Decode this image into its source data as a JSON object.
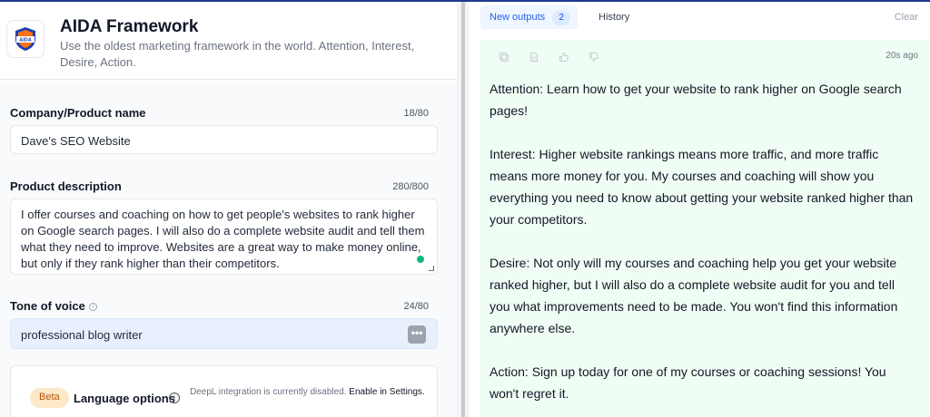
{
  "app": {
    "title": "AIDA Framework",
    "subtitle": "Use the oldest marketing framework in the world. Attention, Interest, Desire, Action.",
    "logo_text": "AIDA"
  },
  "form": {
    "company": {
      "label": "Company/Product name",
      "counter": "18/80",
      "value": "Dave's SEO Website"
    },
    "description": {
      "label": "Product description",
      "counter": "280/800",
      "value": "I offer courses and coaching on how to get people's websites to rank higher on Google search pages. I will also do a complete website audit and tell them what they need to improve. Websites are a great way to make money online, but only if they rank higher than their competitors."
    },
    "tone": {
      "label": "Tone of voice",
      "counter": "24/80",
      "value": "professional blog writer",
      "more_label": "•••"
    },
    "language": {
      "badge": "Beta",
      "label": "Language options",
      "note": "DeepL integration is currently disabled.",
      "link": "Enable in Settings."
    }
  },
  "outputs": {
    "tab_new": "New outputs",
    "tab_new_count": "2",
    "tab_history": "History",
    "clear": "Clear",
    "time": "20s ago",
    "icons": [
      "copy-icon",
      "document-icon",
      "thumbs-up-icon",
      "thumbs-down-icon"
    ],
    "paragraphs": [
      "Attention: Learn how to get your website to rank higher on Google search pages!",
      "Interest: Higher website rankings means more traffic, and more traffic means more money for you. My courses and coaching will show you everything you need to know about getting your website ranked higher than your competitors.",
      "Desire: Not only will my courses and coaching help you get your website ranked higher, but I will also do a complete website audit for you and tell you what improvements need to be made. You won't find this information anywhere else.",
      "Action: Sign up today for one of my courses or coaching sessions! You won't regret it."
    ]
  },
  "colors": {
    "accent": "#2563eb",
    "output_bg": "#f0fdf4",
    "beta_bg": "#fde8c7",
    "logo_orange": "#f97316",
    "logo_blue": "#1e40af"
  }
}
